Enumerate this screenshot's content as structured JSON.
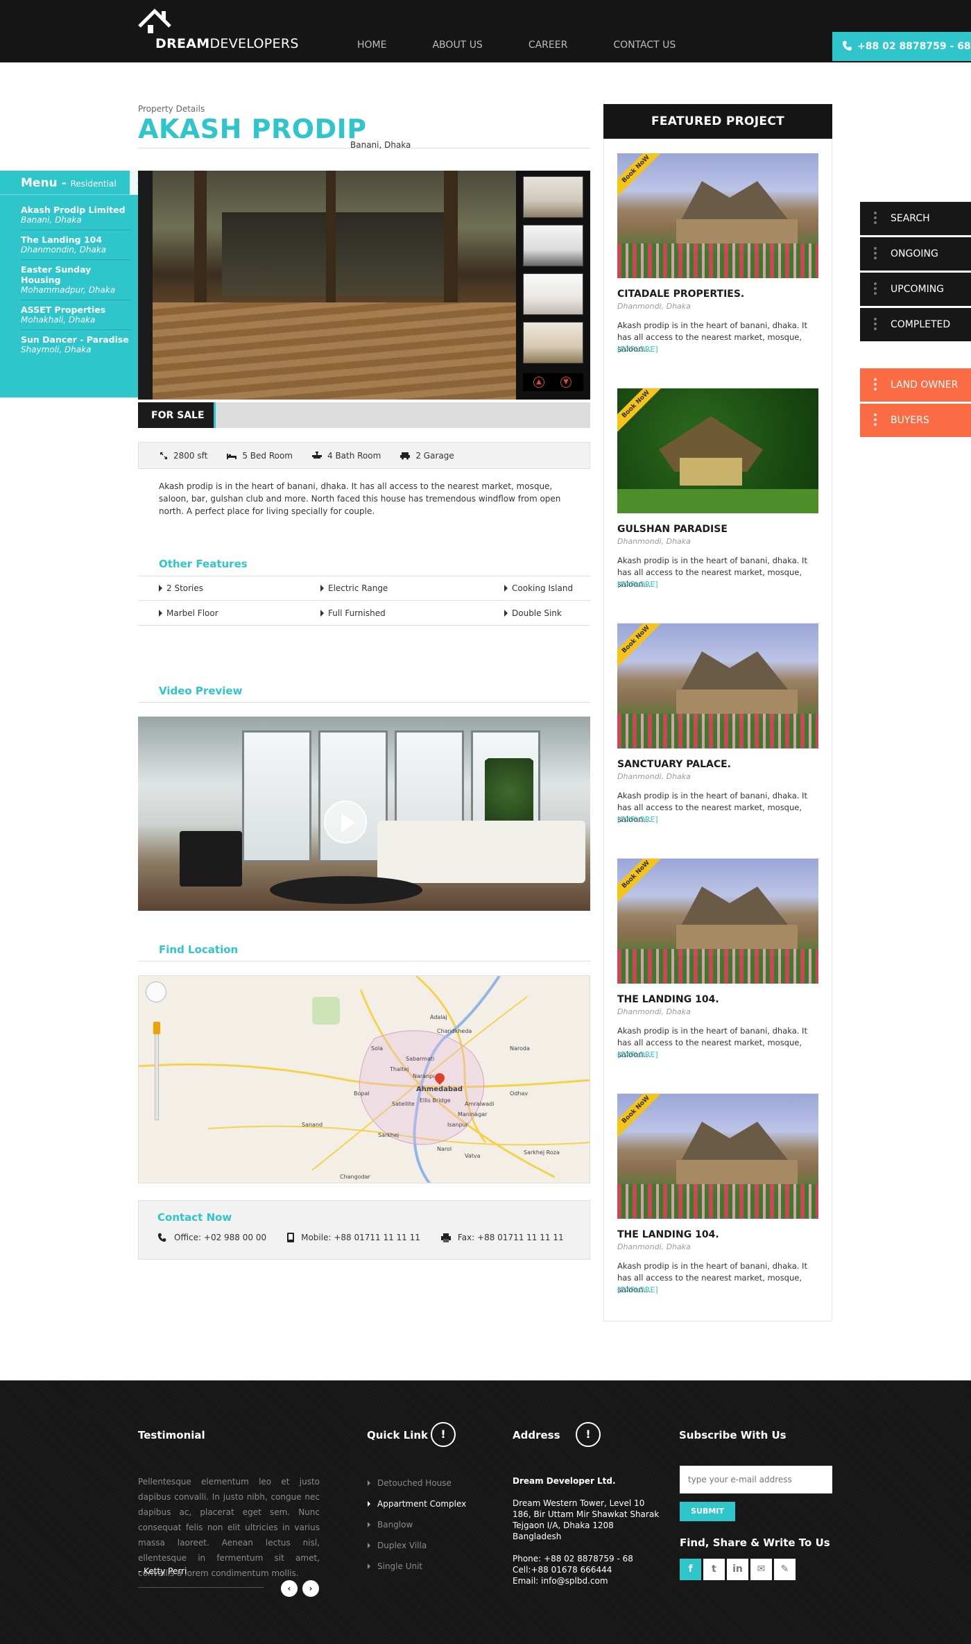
{
  "header": {
    "logo_bold": "DREAM",
    "logo_light": "DEVELOPERS",
    "nav": [
      "HOME",
      "ABOUT US",
      "CAREER",
      "CONTACT US"
    ],
    "phone": "+88 02 8878759 - 68"
  },
  "left_menu": {
    "title": "Menu -",
    "subtitle": "Residential",
    "items": [
      {
        "name": "Akash Prodip Limited",
        "location": "Banani, Dhaka"
      },
      {
        "name": "The Landing 104",
        "location": "Dhanmondin, Dhaka"
      },
      {
        "name": "Easter Sunday Housing",
        "location": "Mohammadpur, Dhaka"
      },
      {
        "name": "ASSET Properties",
        "location": "Mohakhali, Dhaka"
      },
      {
        "name": "Sun Dancer - Paradise",
        "location": "Shaymoli, Dhaka"
      }
    ]
  },
  "side_tabs": {
    "dark": [
      "SEARCH",
      "ONGOING",
      "UPCOMING",
      "COMPLETED"
    ],
    "orange": [
      "LAND OWNER",
      "BUYERS"
    ]
  },
  "property": {
    "crumb": "Property Details",
    "title": "AKASH PRODIP",
    "location": "Banani, Dhaka",
    "sale_tag": "FOR SALE",
    "specs": {
      "area": "2800 sft",
      "bed": "5 Bed Room",
      "bath": "4 Bath Room",
      "garage": "2 Garage"
    },
    "description": "Akash prodip is in the heart of banani, dhaka. It has all access to the nearest market, mosque, saloon, bar, gulshan club and more. North faced this house has tremendous windflow from open north. A perfect place for living specially for couple."
  },
  "sections": {
    "features_title": "Other Features",
    "video_title": "Video Preview",
    "location_title": "Find Location",
    "contact_title": "Contact Now"
  },
  "features": [
    [
      "2 Stories",
      "Electric Range",
      "Cooking Island"
    ],
    [
      "Marbel Floor",
      "Full Furnished",
      "Double Sink"
    ]
  ],
  "map_labels": [
    "Chandkheda",
    "Sabarmati",
    "Naroda",
    "Naranpura",
    "Ahmedabad",
    "Odhav",
    "Vatva",
    "Narol",
    "Sarkhej",
    "Bopal",
    "Satellite",
    "Ellis Bridge",
    "Maninagar",
    "Isanpur",
    "Thaltej",
    "Adalaj",
    "Sola",
    "Amraiwadi",
    "Changodar",
    "Sanand",
    "Sarkhej Roza"
  ],
  "contact": {
    "office": "Office: +02 988 00 00",
    "mobile": "Mobile: +88 01711 11 11 11",
    "fax": "Fax: +88 01711 11 11 11"
  },
  "featured": {
    "title": "FEATURED PROJECT",
    "ribbon": "Book NoW",
    "explore": "[EXPLORE]",
    "items": [
      {
        "name": "CITADALE PROPERTIES.",
        "location": "Dhanmondi, Dhaka",
        "text": "Akash prodip is in the heart of banani, dhaka. It has all access to the nearest market, mosque, saloon..."
      },
      {
        "name": "GULSHAN PARADISE",
        "location": "Dhanmondi, Dhaka",
        "text": "Akash prodip is in the heart of banani, dhaka. It has all access to the nearest market, mosque, saloon..."
      },
      {
        "name": "SANCTUARY PALACE.",
        "location": "Dhanmondi, Dhaka",
        "text": "Akash prodip is in the heart of banani, dhaka. It has all access to the nearest market, mosque, saloon..."
      },
      {
        "name": "THE LANDING 104.",
        "location": "Dhanmondi, Dhaka",
        "text": "Akash prodip is in the heart of banani, dhaka. It has all access to the nearest market, mosque, saloon..."
      },
      {
        "name": "THE LANDING 104.",
        "location": "Dhanmondi, Dhaka",
        "text": "Akash prodip is in the heart of banani, dhaka. It has all access to the nearest market, mosque, saloon..."
      }
    ]
  },
  "footer": {
    "testimonial_title": "Testimonial",
    "testimonial_text": "Pellentesque elementum leo et justo dapibus convalli. In justo nibh, congue nec dapibus ac, placerat eget sem. Nunc consequat felis non elit ultricies in varius massa laoreet. Aenean lectus nisl, ellentesque in fermentum sit amet, convallis a lorem condimentum mollis.",
    "testimonial_author": "- Ketty Perri",
    "quick_link_title": "Quick Link",
    "quick_links": [
      "Detouched House",
      "Appartment Complex",
      "Banglow",
      "Duplex Villa",
      "Single Unit"
    ],
    "address_title": "Address",
    "company": "Dream Developer Ltd.",
    "address_lines": [
      "Dream Western Tower, Level 10",
      "186, Bir Uttam Mir Shawkat Sharak",
      "Tejgaon I/A, Dhaka 1208",
      "Bangladesh"
    ],
    "contact_lines": [
      "Phone: +88 02 8878759 - 68",
      "Cell:+88 01678 666444",
      "Email: info@splbd.com"
    ],
    "subscribe_title": "Subscribe With Us",
    "subscribe_placeholder": "type your e-mail address",
    "submit_label": "SUBMIT",
    "social_title": "Find, Share & Write To Us",
    "social": [
      "f",
      "t",
      "in",
      "✉",
      "✎"
    ],
    "info_glyph": "!",
    "prev_glyph": "‹",
    "next_glyph": "›"
  },
  "colors": {
    "accent": "#2ec5cb",
    "orange": "#fb6c44",
    "dark": "#161616"
  }
}
